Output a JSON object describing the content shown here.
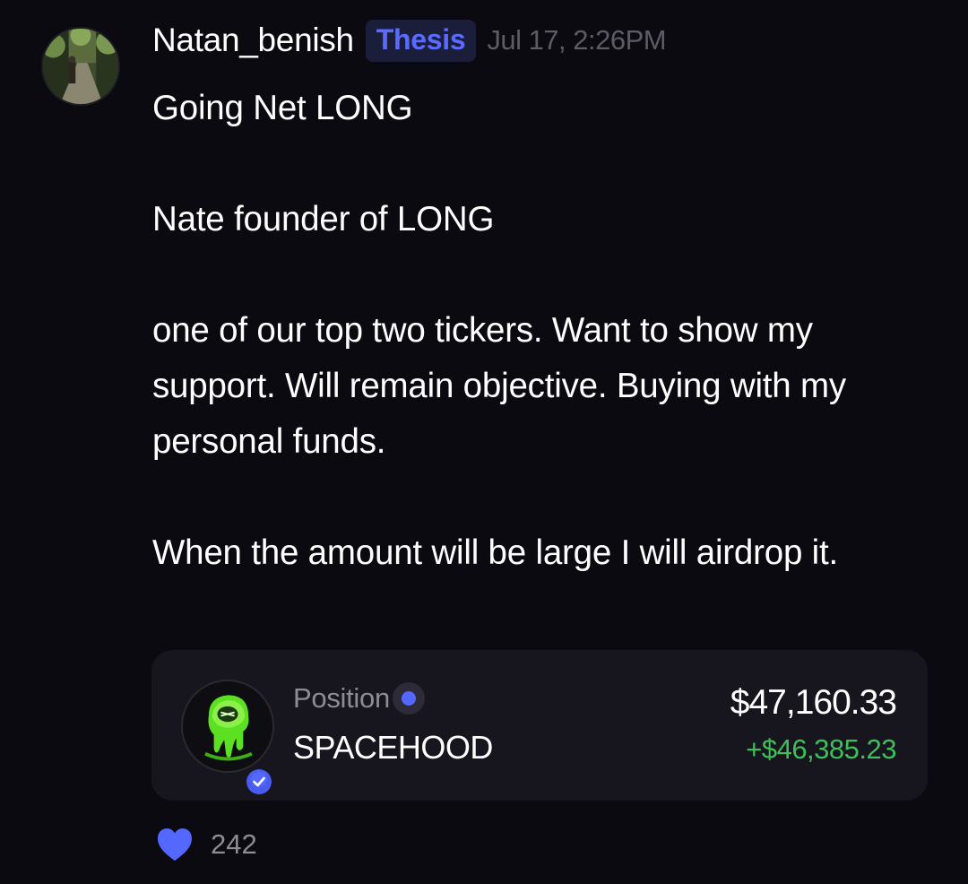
{
  "post": {
    "author": "Natan_benish",
    "tag": "Thesis",
    "timestamp": "Jul 17, 2:26PM",
    "paragraphs": [
      "Going Net LONG",
      "Nate founder of LONG",
      "one of our top two tickers. Want to show my support. Will remain objective. Buying with my personal funds.",
      "When the amount will be large I will airdrop it."
    ]
  },
  "position_card": {
    "label": "Position",
    "ticker": "SPACEHOOD",
    "value": "$47,160.33",
    "pnl": "+$46,385.23",
    "token_icon": "slime-planet-icon",
    "badge_icon": "verified-check-icon",
    "status_icon": "status-dot-icon"
  },
  "reactions": {
    "like_icon": "heart-icon",
    "like_count": "242"
  },
  "colors": {
    "background": "#0b0a10",
    "card": "#17161e",
    "accent": "#5468ff",
    "tag_text": "#5b6bff",
    "positive": "#3fbf5a",
    "muted": "#8d8c96"
  }
}
